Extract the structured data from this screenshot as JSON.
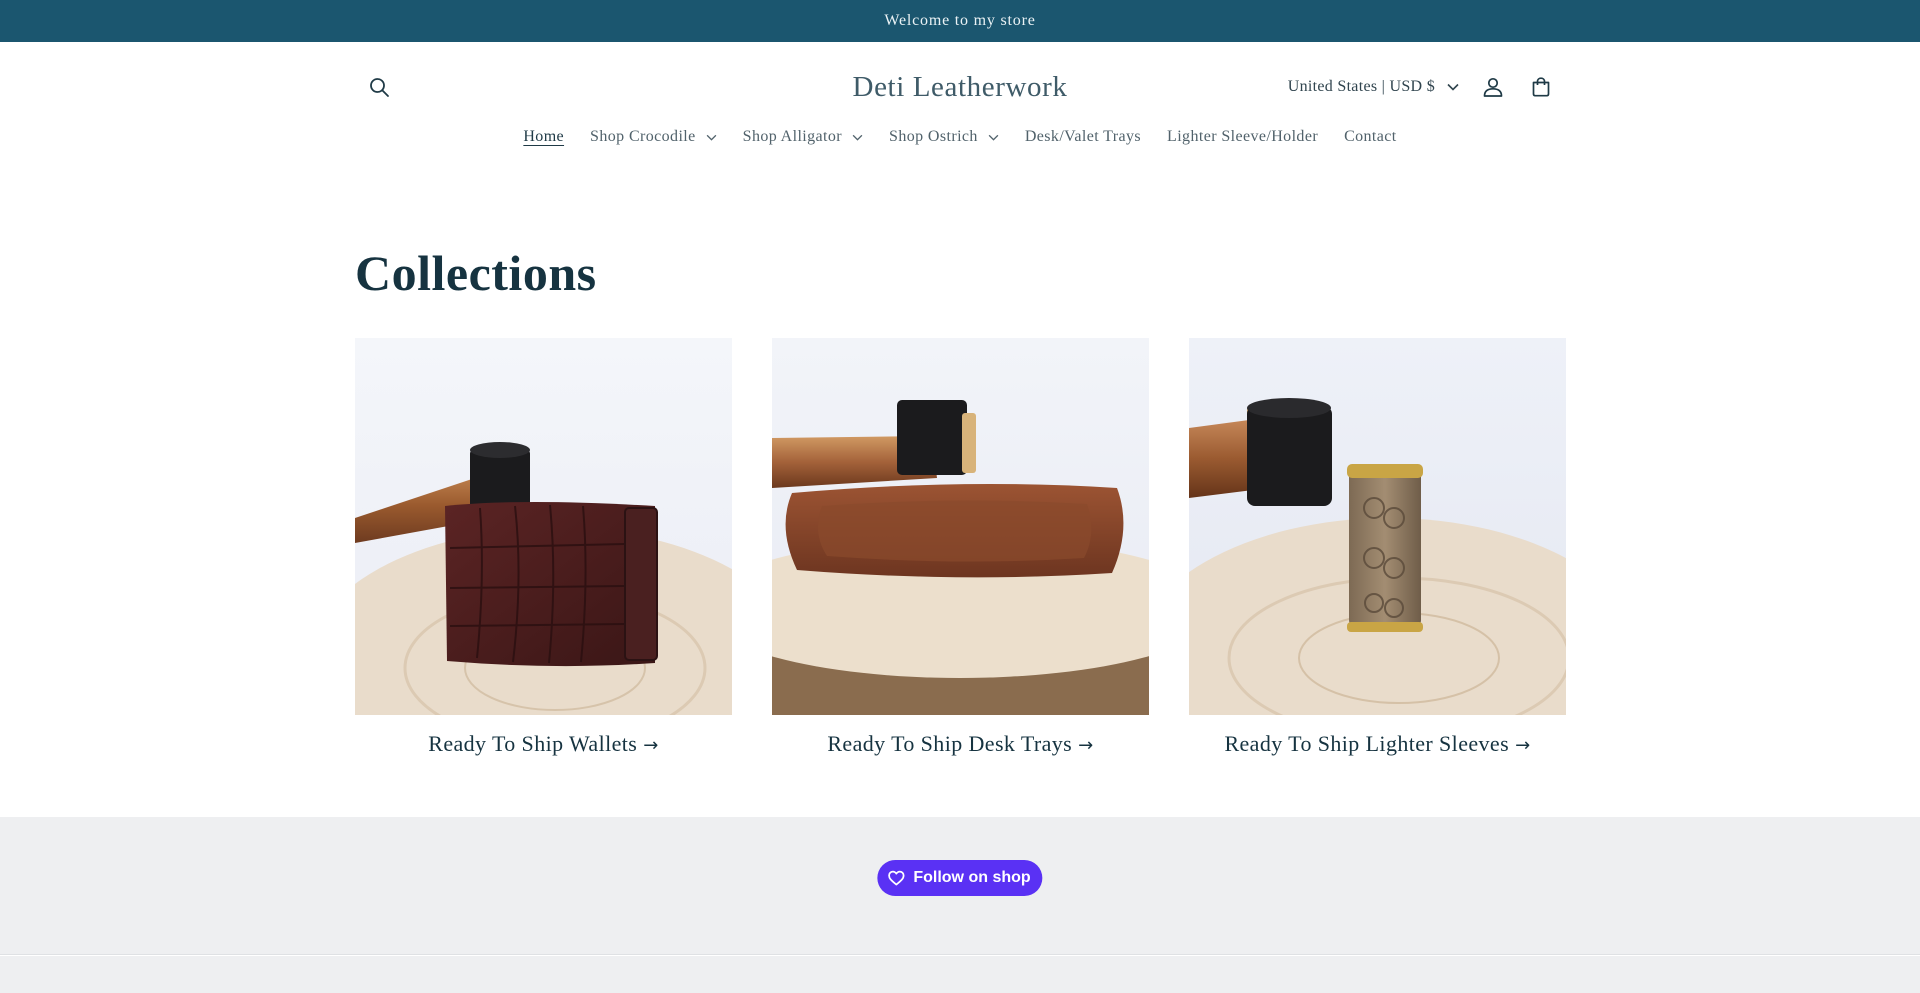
{
  "announcement": {
    "text": "Welcome to my store"
  },
  "header": {
    "logo": "Deti Leatherwork",
    "localization": "United States | USD $"
  },
  "nav": {
    "items": [
      {
        "label": "Home",
        "dropdown": false,
        "active": true
      },
      {
        "label": "Shop Crocodile",
        "dropdown": true
      },
      {
        "label": "Shop Alligator",
        "dropdown": true
      },
      {
        "label": "Shop Ostrich",
        "dropdown": true
      },
      {
        "label": "Desk/Valet Trays",
        "dropdown": false
      },
      {
        "label": "Lighter Sleeve/Holder",
        "dropdown": false
      },
      {
        "label": "Contact",
        "dropdown": false
      }
    ]
  },
  "collections": {
    "title": "Collections",
    "cards": [
      {
        "title": "Ready To Ship Wallets"
      },
      {
        "title": "Ready To Ship Desk Trays"
      },
      {
        "title": "Ready To Ship Lighter Sleeves"
      }
    ]
  },
  "follow": {
    "label": "Follow on shop"
  },
  "colors": {
    "announcement_bg": "#1b566f",
    "heading": "#163340",
    "shop_purple": "#5a31f4",
    "band_bg": "#eeeff1"
  }
}
